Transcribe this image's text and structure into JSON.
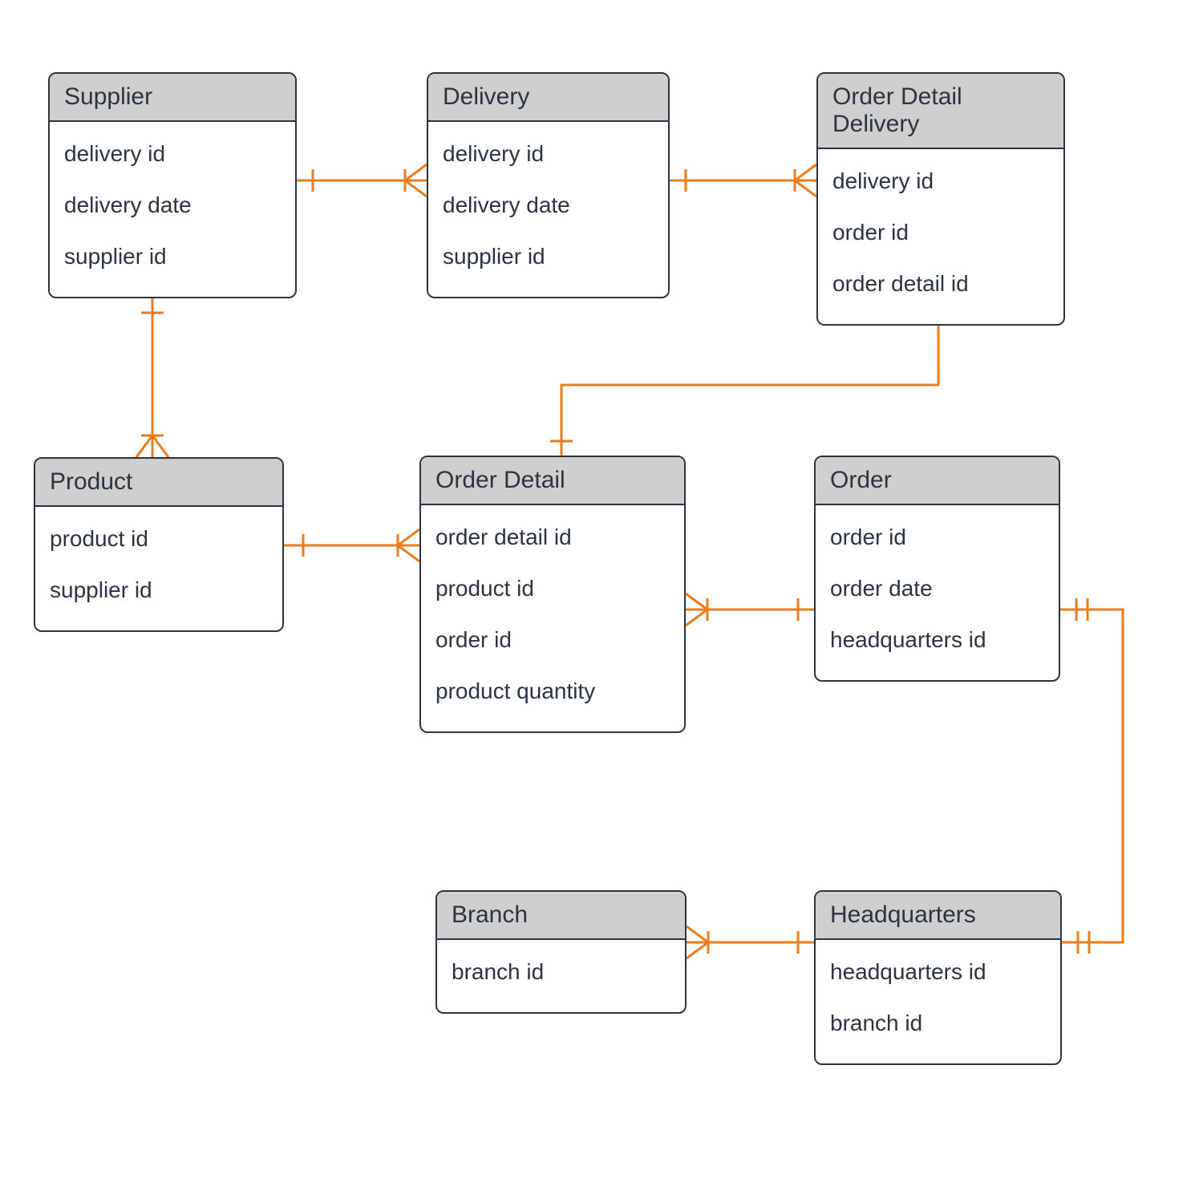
{
  "entities": {
    "supplier": {
      "title": "Supplier",
      "fields": [
        "delivery id",
        "delivery date",
        "supplier id"
      ]
    },
    "delivery": {
      "title": "Delivery",
      "fields": [
        "delivery id",
        "delivery date",
        "supplier id"
      ]
    },
    "order_detail_delivery": {
      "title": "Order Detail Delivery",
      "fields": [
        "delivery id",
        "order id",
        "order detail id"
      ]
    },
    "product": {
      "title": "Product",
      "fields": [
        "product id",
        "supplier id"
      ]
    },
    "order_detail": {
      "title": "Order Detail",
      "fields": [
        "order detail id",
        "product id",
        "order id",
        "product quantity"
      ]
    },
    "order": {
      "title": "Order",
      "fields": [
        "order id",
        "order date",
        "headquarters id"
      ]
    },
    "branch": {
      "title": "Branch",
      "fields": [
        "branch id"
      ]
    },
    "headquarters": {
      "title": "Headquarters",
      "fields": [
        "headquarters id",
        "branch id"
      ]
    }
  },
  "relationships": [
    {
      "from": "supplier",
      "to": "delivery",
      "type": "one-to-many"
    },
    {
      "from": "delivery",
      "to": "order_detail_delivery",
      "type": "one-to-many"
    },
    {
      "from": "supplier",
      "to": "product",
      "type": "one-to-many"
    },
    {
      "from": "product",
      "to": "order_detail",
      "type": "one-to-many"
    },
    {
      "from": "order_detail",
      "to": "order_detail_delivery",
      "type": "one-to-many"
    },
    {
      "from": "order",
      "to": "order_detail",
      "type": "one-to-many"
    },
    {
      "from": "headquarters",
      "to": "order",
      "type": "one-to-one"
    },
    {
      "from": "headquarters",
      "to": "branch",
      "type": "one-to-many"
    }
  ]
}
